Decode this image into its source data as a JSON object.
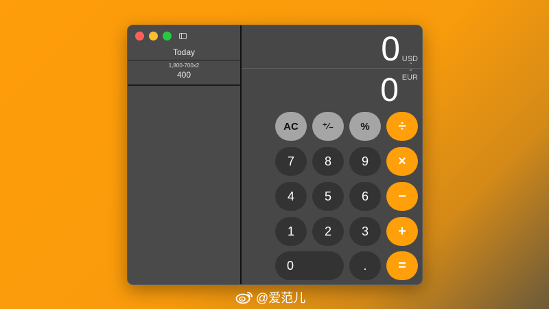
{
  "sidebar": {
    "title": "Today",
    "entries": [
      {
        "expression": "1,800-700x2",
        "result": "400"
      }
    ]
  },
  "display": {
    "primary": "0",
    "primary_unit": "USD",
    "swap_glyph": "⌃⌄",
    "secondary": "0",
    "secondary_unit": "EUR"
  },
  "keypad": {
    "row1": [
      "AC",
      "⁺∕₋",
      "%",
      "÷"
    ],
    "row2": [
      "7",
      "8",
      "9",
      "×"
    ],
    "row3": [
      "4",
      "5",
      "6",
      "−"
    ],
    "row4": [
      "1",
      "2",
      "3",
      "+"
    ],
    "row5": [
      "0",
      ".",
      "="
    ]
  },
  "watermark": {
    "text": "@爱范儿"
  },
  "colors": {
    "operator": "#ff9f0a",
    "function_key": "#a5a5a5",
    "digit_key": "#333333",
    "window": "#484848"
  }
}
